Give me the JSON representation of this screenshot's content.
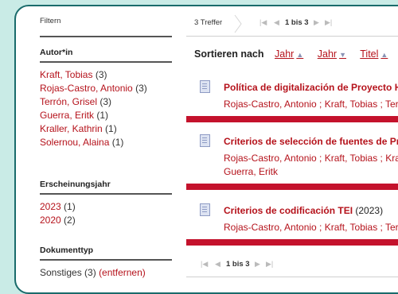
{
  "filters": {
    "heading": "Filtern",
    "groups": [
      {
        "title": "Autor*in",
        "items": [
          {
            "label": "Kraft, Tobias",
            "count": "(3)"
          },
          {
            "label": "Rojas-Castro, Antonio",
            "count": "(3)"
          },
          {
            "label": "Terrón, Grisel",
            "count": "(3)"
          },
          {
            "label": "Guerra, Eritk",
            "count": "(1)"
          },
          {
            "label": "Kraller, Kathrin",
            "count": "(1)"
          },
          {
            "label": "Solernou, Alaina",
            "count": "(1)"
          }
        ]
      },
      {
        "title": "Erscheinungsjahr",
        "items": [
          {
            "label": "2023",
            "count": "(1)"
          },
          {
            "label": "2020",
            "count": "(2)"
          }
        ]
      },
      {
        "title": "Dokumenttyp",
        "items": [
          {
            "label": "Sonstiges",
            "count": "(3)",
            "remove": "(entfernen)"
          }
        ]
      }
    ]
  },
  "results": {
    "hits": "3 Treffer",
    "page_label": "1 bis 3",
    "sort": {
      "label": "Sortieren nach",
      "options": [
        {
          "label": "Jahr",
          "arrow": "▲"
        },
        {
          "label": "Jahr",
          "arrow": "▼"
        },
        {
          "label": "Titel",
          "arrow": "▲"
        }
      ]
    },
    "records": [
      {
        "title": "Política de digitalización de Proyecto Hum",
        "year": "",
        "authors": [
          "Rojas-Castro, Antonio ; Kraft, Tobias ; Terr"
        ]
      },
      {
        "title": "Criterios de selección de fuentes de Proye",
        "year": "",
        "authors": [
          "Rojas-Castro, Antonio ; Kraft, Tobias ; Kral",
          "Guerra, Eritk"
        ]
      },
      {
        "title": "Criterios de codificación TEI",
        "year": "(2023)",
        "authors": [
          "Rojas-Castro, Antonio ; Kraft, Tobias ; Terr"
        ]
      }
    ]
  },
  "colors": {
    "accent": "#b5121b",
    "bar": "#c4122c",
    "frame": "#1a6b6b",
    "background": "#c9ebe6"
  }
}
